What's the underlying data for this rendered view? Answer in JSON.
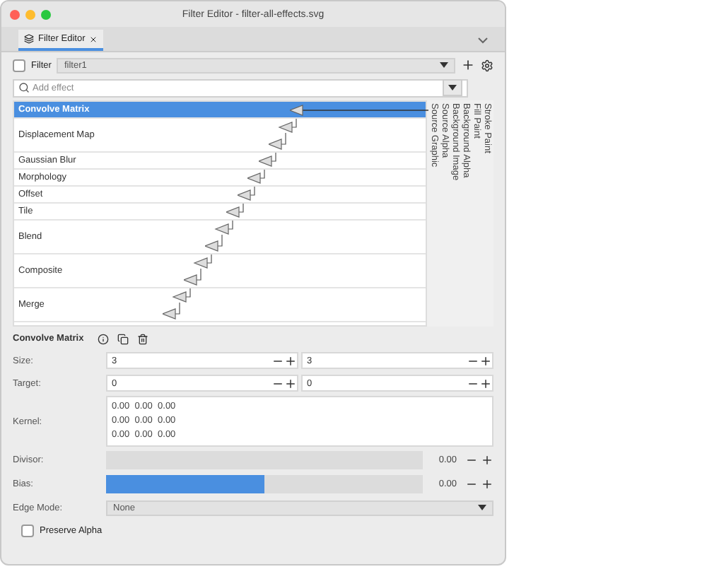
{
  "window": {
    "title": "Filter Editor - filter-all-effects.svg"
  },
  "tabs": [
    {
      "label": "Filter Editor",
      "selected": true
    }
  ],
  "filter_bar": {
    "checkbox_label": "Filter",
    "checked": false,
    "value": "filter1"
  },
  "effect_search": {
    "placeholder": "Add effect"
  },
  "effects": [
    {
      "name": "Convolve Matrix",
      "selected": true,
      "kind": "single"
    },
    {
      "name": "Displacement Map",
      "selected": false,
      "kind": "double"
    },
    {
      "name": "Gaussian Blur",
      "selected": false,
      "kind": "single"
    },
    {
      "name": "Morphology",
      "selected": false,
      "kind": "single"
    },
    {
      "name": "Offset",
      "selected": false,
      "kind": "single"
    },
    {
      "name": "Tile",
      "selected": false,
      "kind": "single"
    },
    {
      "name": "Blend",
      "selected": false,
      "kind": "double"
    },
    {
      "name": "Composite",
      "selected": false,
      "kind": "double"
    },
    {
      "name": "Merge",
      "selected": false,
      "kind": "double"
    }
  ],
  "sources": [
    "Stroke Paint",
    "Fill Paint",
    "Background Alpha",
    "Background Image",
    "Source Alpha",
    "Source Graphic"
  ],
  "settings": {
    "title": "Convolve Matrix",
    "rows": [
      {
        "kind": "pair",
        "label": "Size:",
        "values": [
          "3",
          "3"
        ]
      },
      {
        "kind": "pair",
        "label": "Target:",
        "values": [
          "0",
          "0"
        ]
      },
      {
        "kind": "matrix",
        "label": "Kernel:",
        "lines": [
          "0.00  0.00  0.00",
          "0.00  0.00  0.00",
          "0.00  0.00  0.00"
        ]
      },
      {
        "kind": "slider",
        "label": "Divisor:",
        "level": 0,
        "reading": "0.00"
      },
      {
        "kind": "slider",
        "label": "Bias:",
        "level": 0.5,
        "reading": "0.00"
      },
      {
        "kind": "select",
        "label": "Edge Mode:",
        "value": "None"
      }
    ],
    "preserve_alpha": {
      "label": "Preserve Alpha",
      "checked": false
    }
  }
}
